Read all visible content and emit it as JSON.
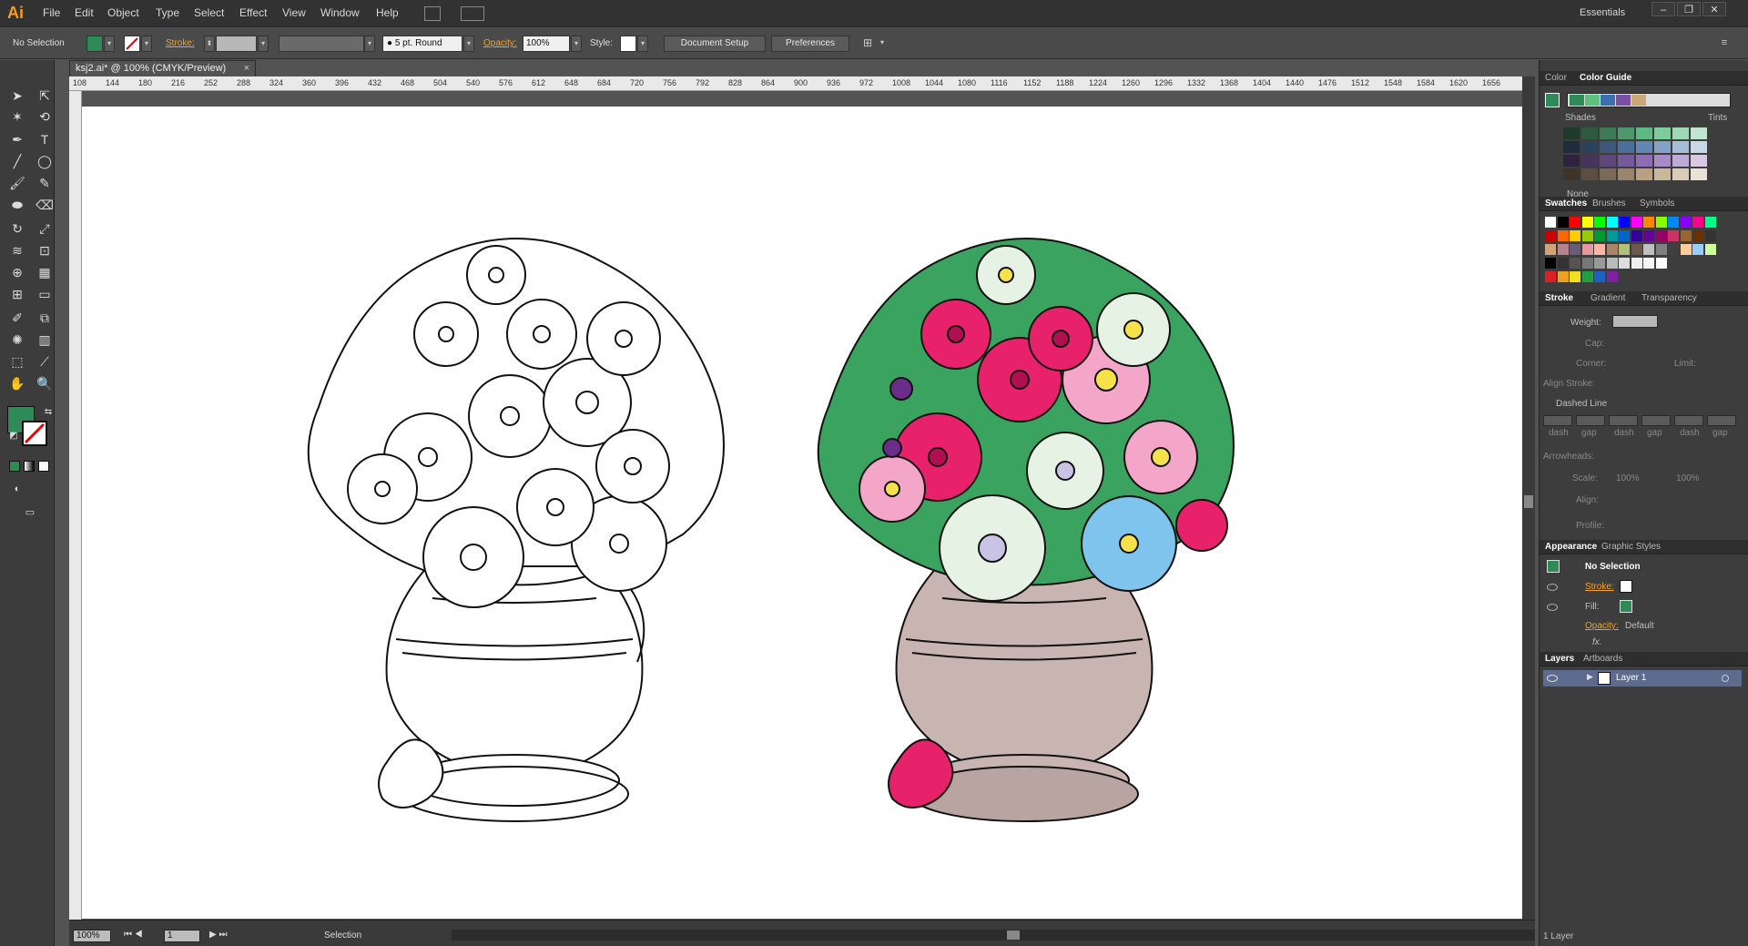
{
  "app": {
    "logo": "Ai"
  },
  "menu": [
    "File",
    "Edit",
    "Object",
    "Type",
    "Select",
    "Effect",
    "View",
    "Window",
    "Help"
  ],
  "workspace": "Essentials",
  "window_controls": [
    "–",
    "❐",
    "✕"
  ],
  "control_bar": {
    "selection": "No Selection",
    "stroke_label": "Stroke:",
    "brush": "5 pt. Round",
    "opacity_label": "Opacity:",
    "opacity_value": "100%",
    "style_label": "Style:",
    "document_setup": "Document Setup",
    "preferences": "Preferences"
  },
  "document_tab": {
    "title": "ksj2.ai* @ 100% (CMYK/Preview)",
    "close": "×"
  },
  "ruler_labels": [
    "108",
    "144",
    "180",
    "216",
    "252",
    "288",
    "324",
    "360",
    "396",
    "432",
    "468",
    "504",
    "540",
    "576",
    "612",
    "648",
    "684",
    "720",
    "756",
    "792",
    "828",
    "864",
    "900",
    "936",
    "972",
    "1008",
    "1044",
    "1080",
    "1116",
    "1152",
    "1188",
    "1224",
    "1260",
    "1296",
    "1332",
    "1368",
    "1404",
    "1440",
    "1476",
    "1512",
    "1548",
    "1584",
    "1620",
    "1656"
  ],
  "status": {
    "zoom": "100%",
    "artboard": "1",
    "tool": "Selection"
  },
  "color_panel": {
    "tabs": [
      "Color",
      "Color Guide"
    ],
    "shades_label": "Shades",
    "tints_label": "Tints",
    "none_label": "None",
    "guide_colors": [
      "#2e8b57",
      "#5fbf7f",
      "#3b6fb0",
      "#7b4fa3",
      "#c8a878"
    ],
    "shade_grid": [
      [
        "#1e3b2c",
        "#2d5a41",
        "#3d7a56",
        "#4d996b",
        "#5db882",
        "#7ccd9b",
        "#9ed9b5",
        "#c0e6cf"
      ],
      [
        "#1e2c3d",
        "#2c425c",
        "#3b587b",
        "#4a6f9a",
        "#6387b5",
        "#83a2c5",
        "#a5bdd6",
        "#c7d7e6"
      ],
      [
        "#2d233d",
        "#45355c",
        "#5d477b",
        "#75599a",
        "#8d6eb5",
        "#a68bc5",
        "#bfa9d6",
        "#d8c8e6"
      ],
      [
        "#3d342a",
        "#5c4f3f",
        "#7b6a55",
        "#9a856a",
        "#b8a080",
        "#c9b79c",
        "#d9cdb8",
        "#e9e2d5"
      ]
    ]
  },
  "swatches_panel": {
    "tabs": [
      "Swatches",
      "Brushes",
      "Symbols"
    ],
    "row1": [
      "#ffffff",
      "#000000",
      "#ff0000",
      "#ffff00",
      "#00ff00",
      "#00ffff",
      "#0000ff",
      "#ff00ff",
      "#ff8800",
      "#88ff00",
      "#0088ff",
      "#8800ff",
      "#ff0088",
      "#00ff88"
    ],
    "row2": [
      "#cc0000",
      "#ff6600",
      "#ffcc00",
      "#99cc00",
      "#009933",
      "#009999",
      "#0066cc",
      "#330099",
      "#660099",
      "#990066",
      "#cc3366",
      "#996633",
      "#663300",
      "#333333"
    ],
    "row3": [
      "#d4a373",
      "#b5838d",
      "#6d597a",
      "#e5989b",
      "#ffb4a2",
      "#a98467",
      "#adc178",
      "#6c584c",
      "#c0c0c0",
      "#808080",
      "#404040",
      "#ffcc99",
      "#99ccff",
      "#ccff99"
    ],
    "row4": [
      "#000000",
      "#333333",
      "#555555",
      "#777777",
      "#999999",
      "#bbbbbb",
      "#dddddd",
      "#eeeeee",
      "#f5f5f5",
      "#ffffff"
    ],
    "row5": [
      "#e02020",
      "#f0a020",
      "#f0e020",
      "#20a040",
      "#2060c0",
      "#8020a0"
    ]
  },
  "stroke_panel": {
    "tabs": [
      "Stroke",
      "Gradient",
      "Transparency"
    ],
    "weight": "Weight:",
    "cap": "Cap:",
    "corner": "Corner:",
    "limit": "Limit:",
    "align": "Align Stroke:",
    "dashed": "Dashed Line",
    "dash_labels": [
      "dash",
      "gap",
      "dash",
      "gap",
      "dash",
      "gap"
    ],
    "arrowheads": "Arrowheads:",
    "scale": "Scale:",
    "scale1": "100%",
    "scale2": "100%",
    "align2": "Align:",
    "profile": "Profile:"
  },
  "appearance_panel": {
    "tabs": [
      "Appearance",
      "Graphic Styles"
    ],
    "title": "No Selection",
    "stroke": "Stroke:",
    "fill": "Fill:",
    "opacity": "Opacity:",
    "opacity_value": "Default",
    "fx": "fx."
  },
  "layers_panel": {
    "tabs": [
      "Layers",
      "Artboards"
    ],
    "layer_name": "Layer 1",
    "count": "1 Layer"
  },
  "colors": {
    "fill": "#2e8b57",
    "accent": "#f7a21b",
    "layer": "#5d6c8e"
  }
}
